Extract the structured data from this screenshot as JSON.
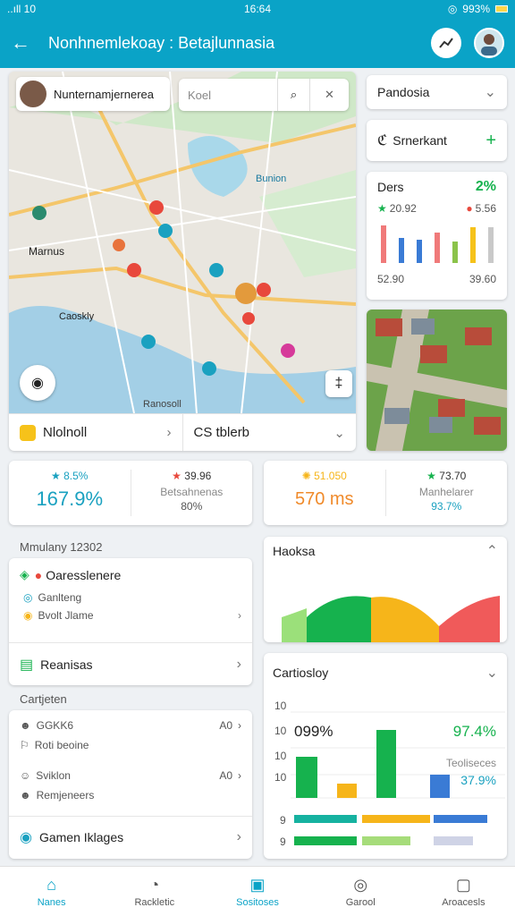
{
  "status": {
    "left": "..ıll 10",
    "time": "16:64",
    "battery": "993%"
  },
  "appbar": {
    "title": "Nonhnemlekoay : Betajlunnasia"
  },
  "map": {
    "user_label": "Nunternamjernerea",
    "search_placeholder": "Koel",
    "labels": {
      "marnus": "Marnus",
      "caoskly": "Caoskly",
      "ranosoll": "Ranosoll",
      "bunion": "Bunion"
    },
    "footer_left": "Nlolnoll",
    "footer_right": "CS tblerb"
  },
  "side": {
    "dropdown": "Pandosia",
    "add_label": "Srnerkant",
    "stats": {
      "title": "Ders",
      "badge": "2%",
      "v1": "20.92",
      "v2": "5.56",
      "f1": "52.90",
      "f2": "39.60"
    }
  },
  "kpi1": {
    "a_top": "8.5%",
    "a_val": "167.9%",
    "b_top": "39.96",
    "b_lbl": "Betsahnenas",
    "b_val": "80%"
  },
  "kpi2": {
    "a_top": "51.050",
    "a_val": "570 ms",
    "b_top": "73.70",
    "b_lbl": "Manhelarer",
    "b_val": "93.7%"
  },
  "list1": {
    "section": "Mmulany 12302",
    "item_title": "Oaresslenere",
    "sub1": "Ganlteng",
    "sub2": "Bvolt Jlame",
    "item2": "Reanisas"
  },
  "list2": {
    "section": "Cartjeten",
    "r1": "GGKK6",
    "r1b": "Roti beoine",
    "r1_val": "A0",
    "r2": "Sviklon",
    "r2b": "Remjeneers",
    "r2_val": "A0",
    "footer": "Gamen Iklages"
  },
  "area": {
    "title": "Haoksa"
  },
  "bars": {
    "title": "Cartiosloy",
    "pct_left": "099%",
    "pct_right": "97.4%",
    "sub_right_lbl": "Teoliseces",
    "sub_right": "37.9%",
    "y1": "10",
    "y2": "10",
    "y3": "10",
    "y4": "10",
    "y5": "9",
    "y6": "9"
  },
  "nav": [
    {
      "label": "Nanes"
    },
    {
      "label": "Rackletic"
    },
    {
      "label": "Sositoses"
    },
    {
      "label": "Garool"
    },
    {
      "label": "Aroacesls"
    }
  ],
  "colors": {
    "primary": "#0aa3c7",
    "green": "#16b24e",
    "yellow": "#f6b51a",
    "red": "#f05a5a",
    "blue": "#3a7bd5"
  }
}
